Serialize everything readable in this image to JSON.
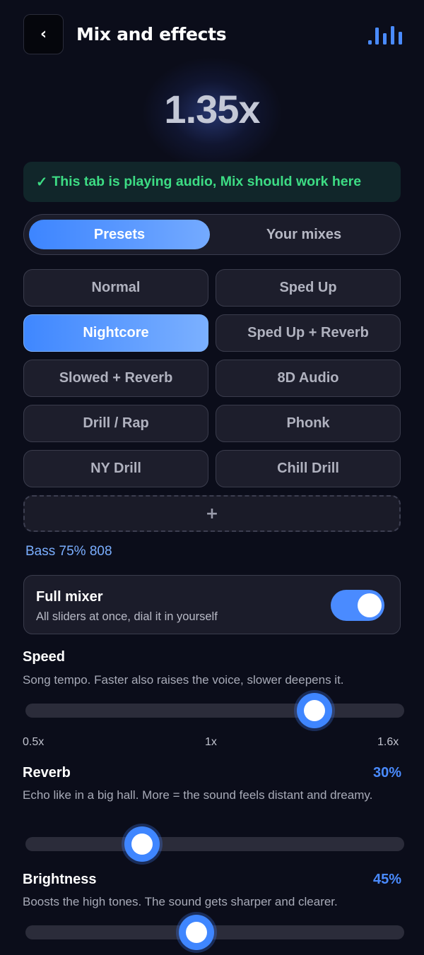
{
  "header": {
    "back_icon": "chevron-left-icon",
    "back_glyph": "‹",
    "title": "Mix and effects",
    "equalizer_icon": "equalizer-bars-icon",
    "accent": "#4a8bff"
  },
  "speed_display": "1.35x",
  "status": {
    "check": "✓",
    "text": "This tab is playing audio, Mix should work here",
    "color": "#3ddc84"
  },
  "tabs": [
    {
      "label": "Presets",
      "active": true
    },
    {
      "label": "Your mixes",
      "active": false
    }
  ],
  "presets": [
    {
      "label": "Normal",
      "active": false
    },
    {
      "label": "Sped Up",
      "active": false
    },
    {
      "label": "Nightcore",
      "active": true
    },
    {
      "label": "Sped Up + Reverb",
      "active": false
    },
    {
      "label": "Slowed + Reverb",
      "active": false
    },
    {
      "label": "8D Audio",
      "active": false
    },
    {
      "label": "Drill / Rap",
      "active": false
    },
    {
      "label": "Phonk",
      "active": false
    },
    {
      "label": "NY Drill",
      "active": false
    },
    {
      "label": "Chill Drill",
      "active": false
    }
  ],
  "add_preset_label": "+",
  "bass_info": "Bass 75% 808",
  "full_mixer": {
    "title": "Full mixer",
    "description": "All sliders at once, dial it in yourself",
    "enabled": true
  },
  "sliders": {
    "speed": {
      "title": "Speed",
      "description": "Song tempo. Faster also raises the voice, slower deepens it.",
      "min_label": "0.5x",
      "mid_label": "1x",
      "max_label": "1.6x",
      "min": 0.5,
      "max": 1.6,
      "value": 1.35
    },
    "reverb": {
      "title": "Reverb",
      "value_label": "30%",
      "description": "Echo like in a big hall. More = the sound feels distant and dreamy.",
      "value": 0.3
    },
    "brightness": {
      "title": "Brightness",
      "value_label": "45%",
      "description": "Boosts the high tones. The sound gets sharper and clearer.",
      "value": 0.45
    }
  }
}
